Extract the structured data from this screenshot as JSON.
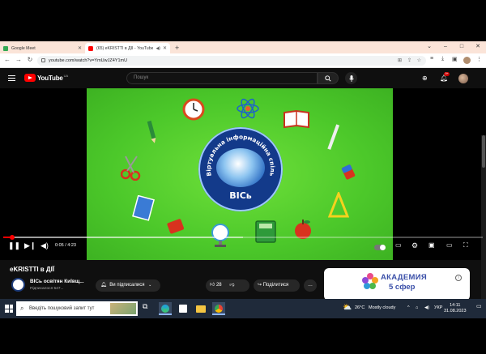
{
  "tabs": [
    {
      "title": "Google Meet",
      "favicon_color": "#34a853"
    },
    {
      "title": "(65) eKRISTTI в ДІЇ - YouTube",
      "favicon_color": "#ff0000"
    }
  ],
  "window_controls": {
    "minimize": "⌄",
    "min": "–",
    "max": "□",
    "close": "✕"
  },
  "address": {
    "url": "youtube.com/watch?v=YmUwJZ4Y1mU"
  },
  "youtube": {
    "logo": "YouTube",
    "region": "UA",
    "search_placeholder": "Пошук",
    "notification_count": "9+"
  },
  "video": {
    "logo_text": "ВІСь",
    "ring_text": "Віртуальна інформаційна спільнота",
    "current_time": "0:05",
    "duration": "4:23",
    "time_label": "0:05 / 4:23",
    "played_fraction": 0.019,
    "buffered_fraction": 0.5
  },
  "below": {
    "title": "eKRISTTI в ДІЇ",
    "channel_name": "ВІСь освітян Київщ...",
    "subscribers": "Підписалося 547...",
    "subscribe_label": "Ви підписалися",
    "like_count": "28",
    "share_label": "Поділитися"
  },
  "ad": {
    "line1": "АКАДЕМИЯ",
    "line2": "5 сфер"
  },
  "taskbar": {
    "search_placeholder": "Введіть пошуковий запит тут",
    "weather_temp": "26°C",
    "weather_desc": "Mostly cloudy",
    "language": "УКР",
    "time": "14:11",
    "date": "31.08.2023"
  }
}
